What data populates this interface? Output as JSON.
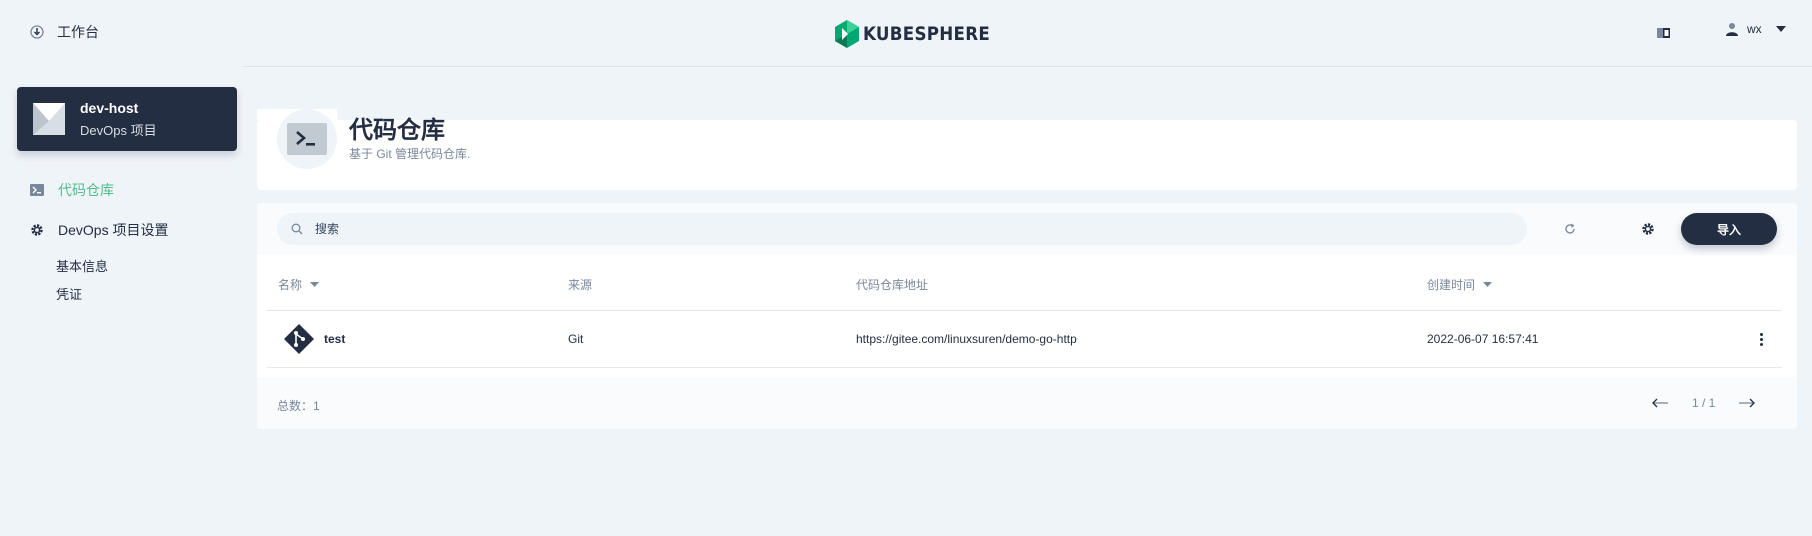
{
  "header": {
    "workbench_label": "工作台",
    "logo_text": "KUBESPHERE",
    "username": "wx"
  },
  "sidebar": {
    "project_name": "dev-host",
    "project_type": "DevOps 项目",
    "nav": [
      {
        "label": "代码仓库",
        "active": true
      },
      {
        "label": "DevOps 项目设置",
        "active": false
      }
    ],
    "sub_items": [
      {
        "label": "基本信息"
      },
      {
        "label": "凭证"
      }
    ]
  },
  "page": {
    "title": "代码仓库",
    "description": "基于 Git 管理代码仓库."
  },
  "toolbar": {
    "search_placeholder": "搜索",
    "import_label": "导入"
  },
  "table": {
    "columns": [
      "名称",
      "来源",
      "代码仓库地址",
      "创建时间"
    ],
    "rows": [
      {
        "name": "test",
        "source": "Git",
        "url": "https://gitee.com/linuxsuren/demo-go-http",
        "created": "2022-06-07 16:57:41"
      }
    ]
  },
  "footer": {
    "total_label": "总数：1",
    "pages": "1 / 1"
  },
  "colors": {
    "accent": "#55bc8a",
    "dark": "#242e42",
    "background": "#eff4f9"
  }
}
